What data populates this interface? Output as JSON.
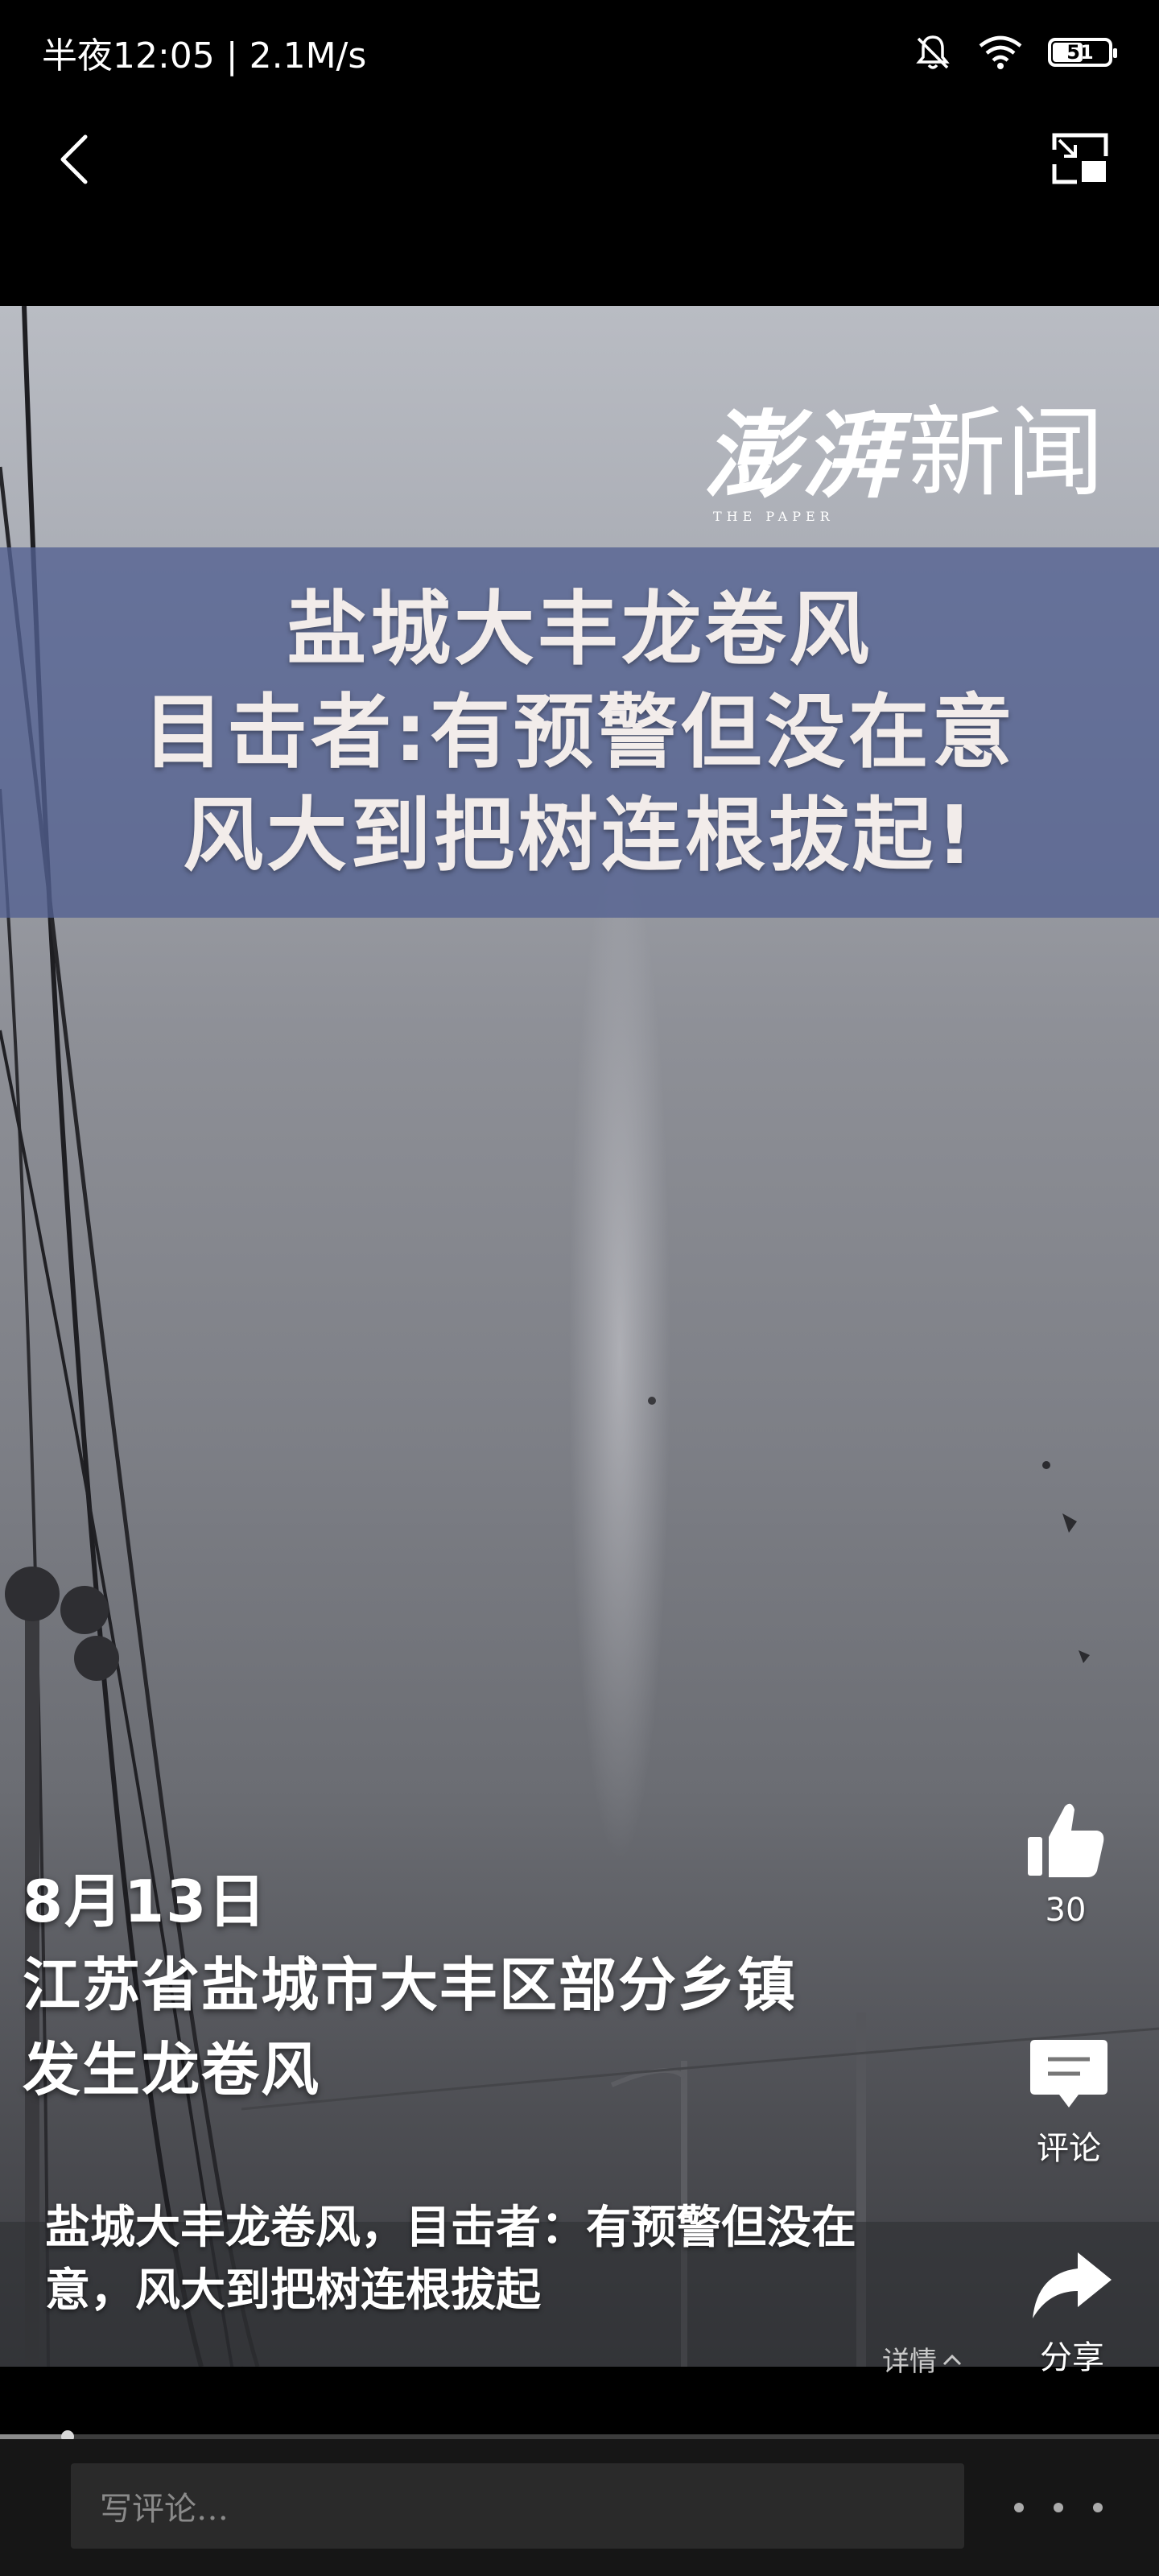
{
  "status_bar": {
    "time": "半夜12:05 | 2.1M/s",
    "battery": "51",
    "icons": [
      "bell-muted-icon",
      "wifi-icon",
      "battery-icon"
    ]
  },
  "nav": {
    "back_icon": "chevron-left-icon",
    "pip_icon": "picture-in-picture-icon"
  },
  "video": {
    "logo_text": "澎湃",
    "logo_text2": "新闻",
    "logo_sub": "THE PAPER",
    "headline": [
      "盐城大丰龙卷风",
      "目击者:有预警但没在意",
      "风大到把树连根拔起!"
    ],
    "caption": [
      "8月13日",
      "江苏省盐城市大丰区部分乡镇",
      "发生龙卷风"
    ]
  },
  "actions": {
    "like_count": "30",
    "comment_label": "评论",
    "share_label": "分享"
  },
  "title": {
    "line1": "盐城大丰龙卷风，目击者：有预警但没在",
    "line2": "意，风大到把树连根拔起",
    "details_label": "详情"
  },
  "progress": {
    "played_fraction": 0.058
  },
  "bottom": {
    "comment_placeholder": "写评论…"
  },
  "colors": {
    "headline_band": "#5260a0",
    "background": "#000000"
  }
}
